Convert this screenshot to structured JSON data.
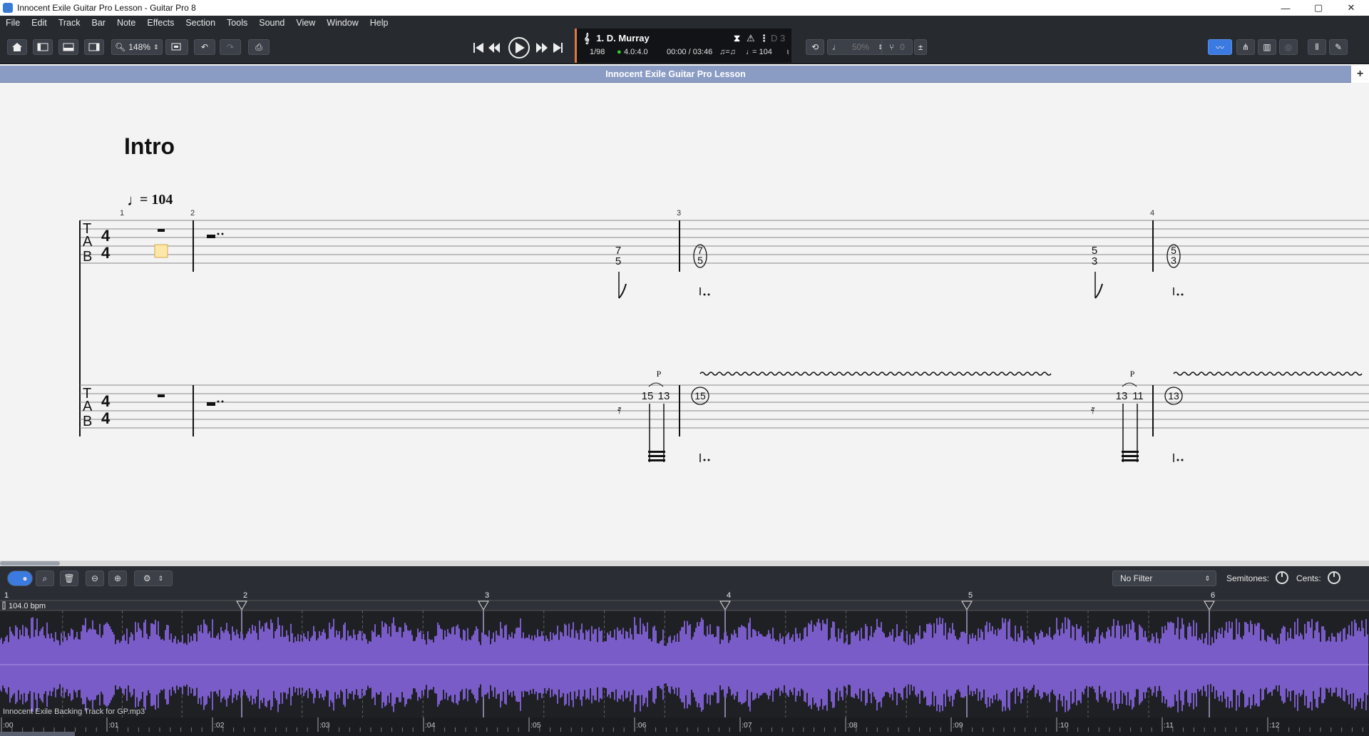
{
  "window": {
    "title": "Innocent Exile Guitar Pro Lesson - Guitar Pro 8",
    "min": "—",
    "max": "▢",
    "close": "✕"
  },
  "menu": [
    "File",
    "Edit",
    "Track",
    "Bar",
    "Note",
    "Effects",
    "Section",
    "Tools",
    "Sound",
    "View",
    "Window",
    "Help"
  ],
  "toolbar": {
    "zoom": "148%",
    "lcd": {
      "track": "1. D. Murray",
      "bar": "1/98",
      "signature": "4.0:4.0",
      "time": "00:00 / 03:46",
      "tempo": "= 104",
      "key": "D 3",
      "speed": "50%",
      "pitch": "0"
    }
  },
  "document": {
    "tab_title": "Innocent Exile Guitar Pro Lesson",
    "add_tab": "+"
  },
  "score": {
    "section": "Intro",
    "tempo_text": "= 104",
    "bar_numbers": [
      "1",
      "2",
      "3",
      "4"
    ],
    "tab_letters": [
      "T",
      "A",
      "B"
    ],
    "time_sig": [
      "4",
      "4"
    ],
    "staff1_notes": [
      {
        "bar": 2,
        "frets": [
          "7",
          "5"
        ]
      },
      {
        "bar": 3,
        "frets": [
          "7",
          "5"
        ],
        "circled": true
      },
      {
        "bar": 3,
        "frets": [
          "5",
          "3"
        ]
      },
      {
        "bar": 4,
        "frets": [
          "5",
          "3"
        ],
        "circled": true
      }
    ],
    "staff2_notes": [
      {
        "frets": [
          "15",
          "13"
        ],
        "technique": "P"
      },
      {
        "frets": [
          "15"
        ],
        "circled": true
      },
      {
        "frets": [
          "13",
          "11"
        ],
        "technique": "P"
      },
      {
        "frets": [
          "13"
        ],
        "circled": true
      }
    ]
  },
  "audio": {
    "filter": "No Filter",
    "semitones_label": "Semitones:",
    "cents_label": "Cents:",
    "tempo_marker": "104.0 bpm",
    "bar_markers": [
      "1",
      "2",
      "3",
      "4",
      "5",
      "6"
    ],
    "file_name": "Innocent Exile Backing Track for GP.mp3",
    "time_ticks": [
      ":00",
      ":01",
      ":02",
      ":03",
      ":04",
      ":05",
      ":06",
      ":07",
      ":08",
      ":09",
      ":10",
      ":11",
      ":12"
    ],
    "waveform_color": "#7a5cc9"
  }
}
